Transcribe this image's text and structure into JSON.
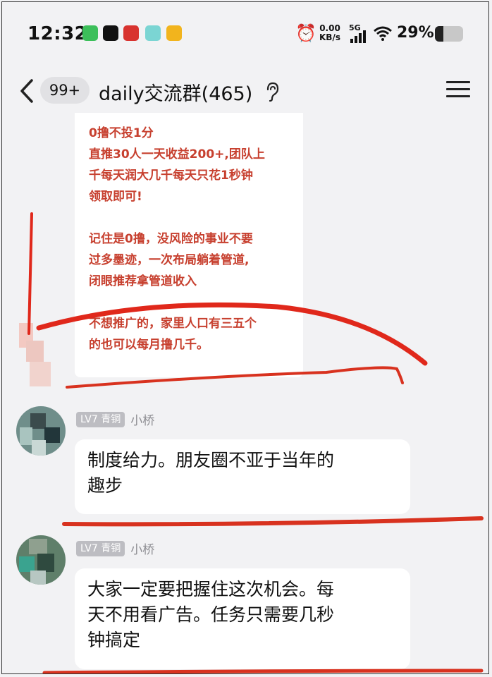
{
  "status_bar": {
    "time": "12:32",
    "net_speed_value": "0.00",
    "net_speed_unit": "KB/s",
    "network": "5G",
    "battery_percent": "29%",
    "battery_level": 0.29,
    "notification_icons": [
      "wechat-icon",
      "capcut-icon",
      "red-app-icon",
      "cyan-app-icon",
      "yellow-app-icon"
    ]
  },
  "header": {
    "unread_badge": "99+",
    "title": "daily交流群(465)"
  },
  "messages": [
    {
      "type": "image-text-card",
      "lines_group1": [
        "0撸不投1分",
        "直推30人一天收益200+,团队上",
        "千每天润大几千每天只花1秒钟",
        "领取即可!"
      ],
      "lines_group2": [
        "记住是0撸，没风险的事业不要",
        "过多墨迹，一次布局躺着管道,",
        "闭眼推荐拿管道收入"
      ],
      "lines_group3": [
        "不想推广的，家里人口有三五个",
        "的也可以每月撸几千。"
      ]
    },
    {
      "type": "text",
      "level": "LV7 青铜",
      "sender": "小桥",
      "text_line1": "制度给力。朋友圈不亚于当年的",
      "text_line2": "趣步"
    },
    {
      "type": "text",
      "level": "LV7 青铜",
      "sender": "小桥",
      "text_line1": "大家一定要把握住这次机会。每",
      "text_line2": "天不用看广告。任务只需要几秒",
      "text_line3": "钟搞定"
    }
  ],
  "colors": {
    "background": "#f2f2f4",
    "card_text": "#c7402f",
    "annotation": "#e0281b",
    "level_badge": "#bdbdc2"
  }
}
